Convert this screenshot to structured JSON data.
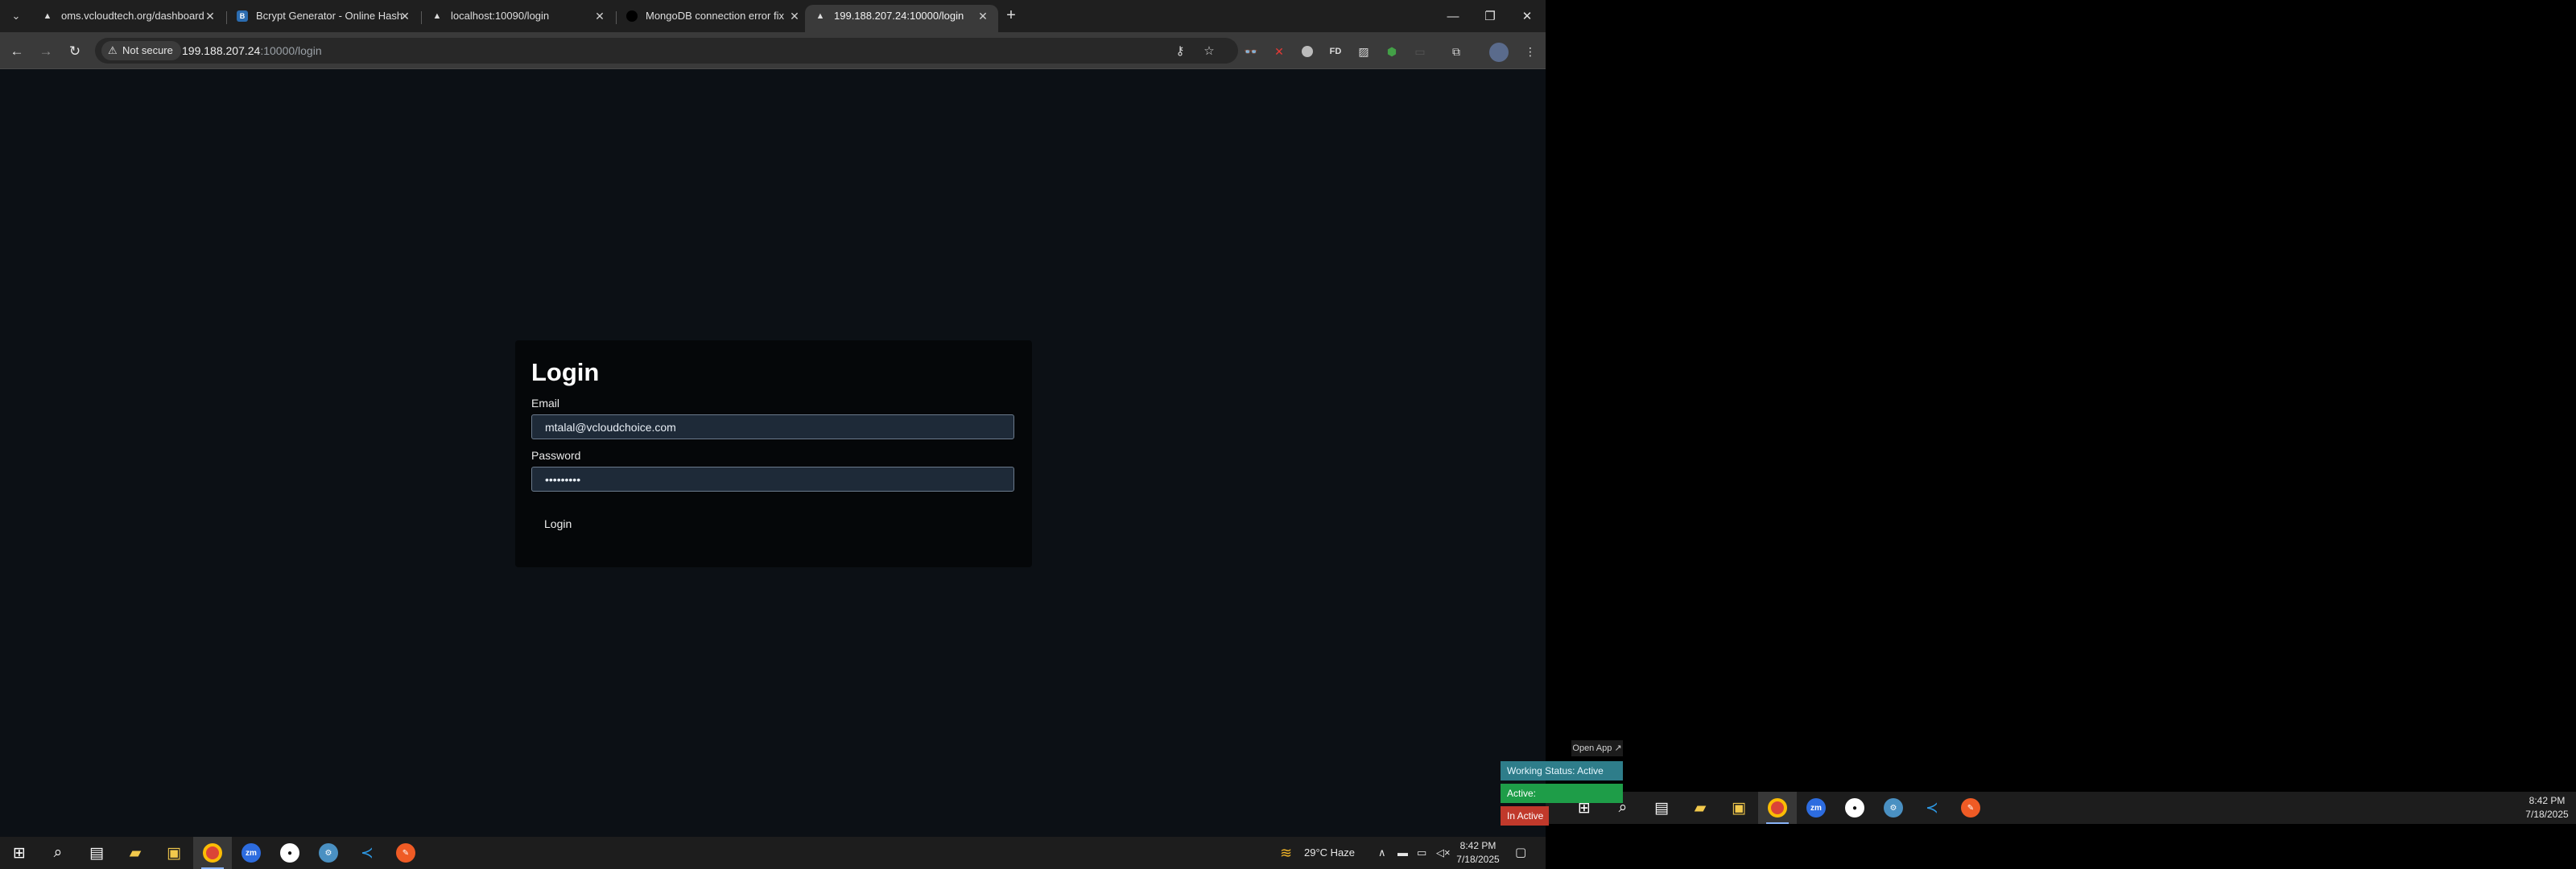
{
  "browser": {
    "tabs": [
      {
        "title": "oms.vcloudtech.org/dashboard",
        "active": false
      },
      {
        "title": "Bcrypt Generator - Online Hash",
        "active": false
      },
      {
        "title": "localhost:10090/login",
        "active": false
      },
      {
        "title": "MongoDB connection error fix",
        "active": false
      },
      {
        "title": "199.188.207.24:10000/login",
        "active": true
      }
    ],
    "security_label": "Not secure",
    "url_host": "199.188.207.24",
    "url_rest": ":10000/login"
  },
  "login": {
    "title": "Login",
    "email_label": "Email",
    "email_value": "mtalal@vcloudchoice.com",
    "password_label": "Password",
    "password_value": "•••••••••",
    "button_label": "Login"
  },
  "taskbar": {
    "weather": "29°C  Haze",
    "time": "8:42 PM",
    "date": "7/18/2025"
  },
  "taskbar2": {
    "time": "8:42 PM",
    "date": "7/18/2025"
  },
  "widget": {
    "open_app": "Open App ↗",
    "working_status": "Working Status: Active",
    "active": "Active:",
    "inactive": "In Active"
  }
}
